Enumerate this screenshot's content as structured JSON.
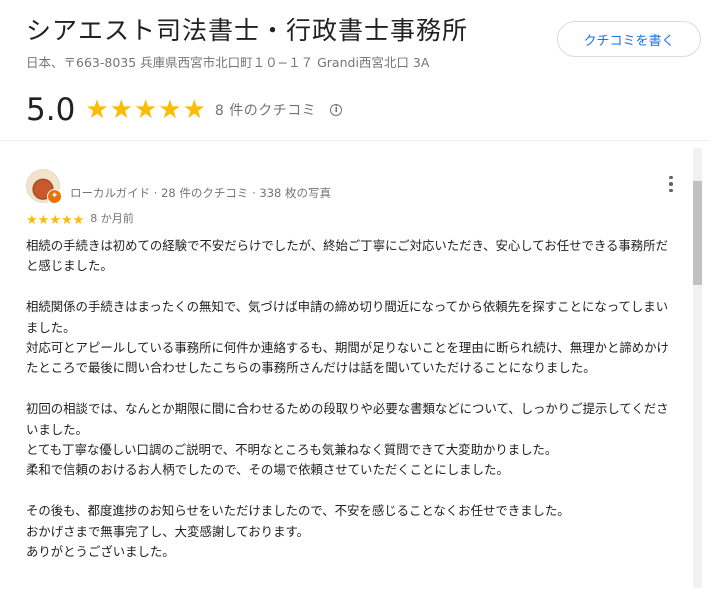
{
  "place": {
    "name": "シアエスト司法書士・行政書士事務所",
    "address": "日本、〒663-8035 兵庫県西宮市北口町１０−１７ Grandi西宮北口 3A"
  },
  "actions": {
    "write_review": "クチコミを書く"
  },
  "summary": {
    "rating": "5.0",
    "stars": 5,
    "review_count": "8 件のクチコミ",
    "info_icon": "info-icon"
  },
  "review": {
    "reviewer_name": "",
    "reviewer_meta": "ローカルガイド · 28 件のクチコミ · 338 枚の写真",
    "stars": 5,
    "date": "8 か月前",
    "text": "相続の手続きは初めての経験で不安だらけでしたが、終始ご丁寧にご対応いただき、安心してお任せできる事務所だと感じました。\n\n相続関係の手続きはまったくの無知で、気づけば申請の締め切り間近になってから依頼先を探すことになってしまいました。\n対応可とアピールしている事務所に何件か連絡するも、期間が足りないことを理由に断られ続け、無理かと諦めかけたところで最後に問い合わせしたこちらの事務所さんだけは話を聞いていただけることになりました。\n\n初回の相談では、なんとか期限に間に合わせるための段取りや必要な書類などについて、しっかりご提示してくださいました。\nとても丁寧な優しい口調のご説明で、不明なところも気兼ねなく質問できて大変助かりました。\n柔和で信頼のおけるお人柄でしたので、その場で依頼させていただくことにしました。\n\nその後も、都度進捗のお知らせをいただけましたので、不安を感じることなくお任せできました。\nおかげさまで無事完了し、大変感謝しております。\nありがとうございました。"
  },
  "colors": {
    "star": "#fbbc04",
    "accent": "#1a73e8",
    "secondary_text": "#70757a"
  }
}
